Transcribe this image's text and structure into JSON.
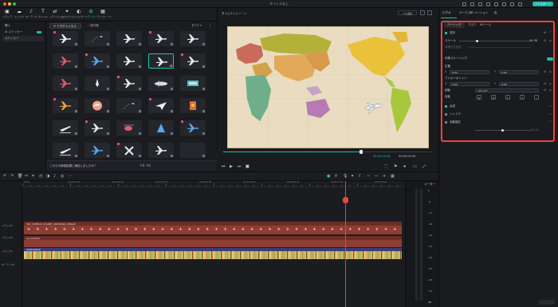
{
  "window": {
    "title": "タイトルなし",
    "export_label": "エクスポート"
  },
  "toolbar": {
    "items": [
      {
        "icon": "media-icon",
        "label": "メディア"
      },
      {
        "icon": "stock-media-icon",
        "label": "ストック"
      },
      {
        "icon": "audio-icon",
        "label": "オーディオ"
      },
      {
        "icon": "title-icon",
        "label": "タイトル"
      },
      {
        "icon": "transition-icon",
        "label": "トランジション"
      },
      {
        "icon": "effects-icon",
        "label": "エフェクト"
      },
      {
        "icon": "filter-icon",
        "label": "フィルター"
      },
      {
        "icon": "sticker-icon",
        "label": "ステッカー"
      },
      {
        "icon": "template-icon",
        "label": "テンプレート"
      }
    ],
    "active_index": 7
  },
  "leftnav": {
    "items": [
      "購入",
      "AI ステッカー",
      "ステッカー"
    ]
  },
  "browser": {
    "tabs": [
      "アダチャンネル",
      "旅行機"
    ],
    "all_label": "すべて"
  },
  "feedback": {
    "question": "これらの検索結果に満足しましたか？"
  },
  "preview": {
    "tabs": [
      "タイムライン",
      "ソース"
    ],
    "quality": "フル品質",
    "time_current": "00:00:04:16",
    "time_total": "00:00:09:00"
  },
  "props": {
    "tabs": [
      "ビデオ",
      "オーディオ",
      "アニメーション",
      "色"
    ],
    "subtabs": [
      "ベーシック",
      "マスク",
      "AIツール"
    ],
    "transform_label": "変形",
    "scale_label": "スケール",
    "scale_value": "18.38",
    "uniform_label": "縦横比を固定",
    "uniform_scale_label": "均等スケーリング",
    "position_label": "位置",
    "pos_x": "0.00",
    "pos_y": "0.00",
    "anchor_label": "アンカーポイント",
    "anchor_x": "0.00",
    "anchor_y": "0.00",
    "rotate_label": "回転",
    "rotate_value": "-211.07°",
    "flip_label": "反転",
    "composite_label": "合成",
    "shadow_label": "シャドウ",
    "auto_enhance_label": "自動補正",
    "auto_value": "50.00",
    "unit_x": "X",
    "unit_y": "Y"
  },
  "timeline": {
    "ruler_labels": [
      "00:00",
      "00:00:01:00",
      "00:00:02:00",
      "00:00:03:00",
      "00:00:04:00",
      "00:00:05:00",
      "00:00:06:00",
      "00:00:07:00",
      "00:00:08:00"
    ],
    "tracks": [
      {
        "label": "トラック3",
        "clip": "001_OVERLAY_PLANE_CROSSING_SINGLE"
      },
      {
        "label": "トラック2",
        "clip": "AI_CLOUDS"
      },
      {
        "label": "トラック1",
        "clip": "WORLDMAP"
      },
      {
        "label": "オーディオ1",
        "clip": ""
      }
    ]
  },
  "meter": {
    "title": "メーター",
    "labels": [
      "0",
      "-6",
      "-12",
      "-18",
      "-24",
      "-30",
      "-36",
      "-42",
      "-48",
      "-54"
    ],
    "unit": "dB"
  },
  "colors": {
    "accent": "#19c3ad",
    "highlight": "#f0413d",
    "track3": "#8e3d33",
    "track2": "#8e3d33",
    "track1": "#c8973e"
  }
}
